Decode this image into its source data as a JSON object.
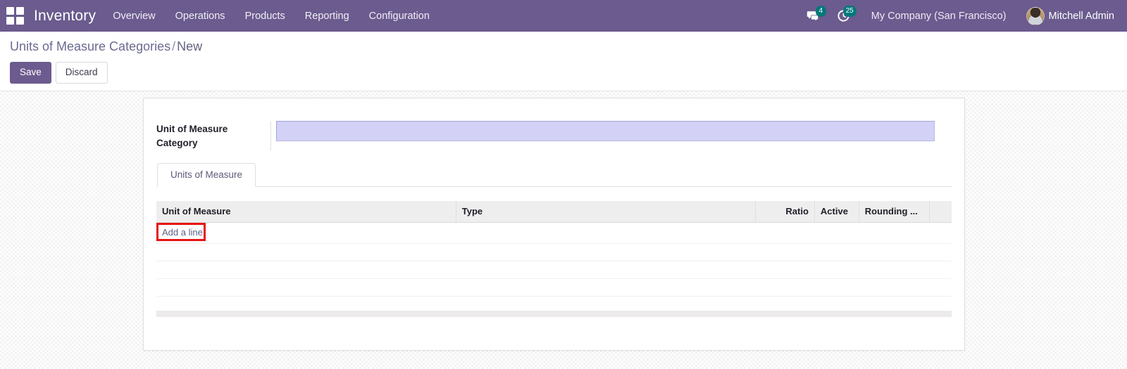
{
  "navbar": {
    "apps_icon": "apps-grid-icon",
    "brand": "Inventory",
    "menu": [
      {
        "label": "Overview"
      },
      {
        "label": "Operations"
      },
      {
        "label": "Products"
      },
      {
        "label": "Reporting"
      },
      {
        "label": "Configuration"
      }
    ],
    "messages_icon": "chat-bubble-icon",
    "messages_count": "4",
    "activities_icon": "clock-activity-icon",
    "activities_count": "25",
    "company": "My Company (San Francisco)",
    "user_avatar": "user-avatar-icon",
    "user_name": "Mitchell Admin",
    "bg_color": "#6b5b8e",
    "badge_color": "#00787a"
  },
  "control_panel": {
    "breadcrumb_root": "Units of Measure Categories",
    "breadcrumb_separator": "/",
    "breadcrumb_current": "New",
    "save_label": "Save",
    "discard_label": "Discard",
    "primary_color": "#6b5b8e"
  },
  "form": {
    "field_label": "Unit of Measure Category",
    "field_value": "",
    "field_placeholder": "",
    "input_bg": "#d3d2f6"
  },
  "notebook": {
    "tabs": [
      {
        "label": "Units of Measure",
        "active": true
      }
    ]
  },
  "list": {
    "columns": [
      {
        "label": "Unit of Measure",
        "align": "left"
      },
      {
        "label": "Type",
        "align": "left"
      },
      {
        "label": "Ratio",
        "align": "right"
      },
      {
        "label": "Active",
        "align": "left"
      },
      {
        "label": "Rounding ...",
        "align": "left"
      },
      {
        "label": "",
        "align": "left"
      }
    ],
    "rows": [],
    "add_line_label": "Add a line",
    "highlight_color": "#e81313"
  }
}
